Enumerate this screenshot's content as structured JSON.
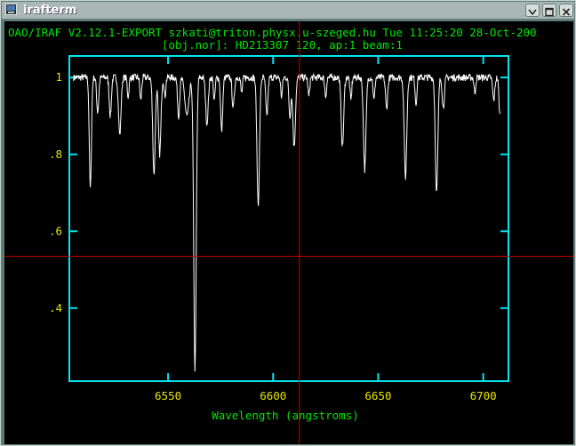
{
  "window": {
    "title": "irafterm",
    "buttons": [
      "minimize",
      "maximize",
      "close"
    ]
  },
  "header": {
    "line1": "OAO/IRAF V2.12.1-EXPORT szkati@triton.physx.u-szeged.hu Tue 11:25:20 28-Oct-200",
    "line2": "[obj.nor]: HD213307 120, ap:1 beam:1"
  },
  "colors": {
    "axes": "#00e5ee",
    "tick_labels": "#e6e600",
    "header_text": "#00e600",
    "spectrum": "#ffffff",
    "cursor": "#cc0000",
    "background": "#000000"
  },
  "chart_data": {
    "type": "line",
    "title": "",
    "xlabel": "Wavelength (angstroms)",
    "ylabel": "",
    "xlim": [
      6503,
      6712
    ],
    "ylim": [
      0.21,
      1.056
    ],
    "x_ticks": [
      6550,
      6600,
      6650,
      6700
    ],
    "x_tick_labels": [
      "6550",
      "6600",
      "6650",
      "6700"
    ],
    "y_ticks": [
      1.0,
      0.8,
      0.6,
      0.4
    ],
    "y_tick_labels": [
      "1",
      ".8",
      ".6",
      ".4"
    ],
    "grid": false,
    "continuum": 1.0,
    "absorption_lines": [
      {
        "x": 6513.0,
        "depth": 0.29,
        "width": 0.5
      },
      {
        "x": 6516.5,
        "depth": 0.09,
        "width": 0.5
      },
      {
        "x": 6522.5,
        "depth": 0.1,
        "width": 0.5
      },
      {
        "x": 6527.0,
        "depth": 0.15,
        "width": 0.6
      },
      {
        "x": 6531.0,
        "depth": 0.05,
        "width": 0.4
      },
      {
        "x": 6537.0,
        "depth": 0.06,
        "width": 0.4
      },
      {
        "x": 6543.3,
        "depth": 0.25,
        "width": 0.6
      },
      {
        "x": 6546.0,
        "depth": 0.2,
        "width": 0.6
      },
      {
        "x": 6548.5,
        "depth": 0.05,
        "width": 0.4
      },
      {
        "x": 6555.0,
        "depth": 0.1,
        "width": 0.5
      },
      {
        "x": 6559.0,
        "depth": 0.1,
        "width": 1.0
      },
      {
        "x": 6562.8,
        "depth": 0.76,
        "width": 0.6
      },
      {
        "x": 6568.5,
        "depth": 0.12,
        "width": 0.6
      },
      {
        "x": 6572.0,
        "depth": 0.06,
        "width": 0.4
      },
      {
        "x": 6575.5,
        "depth": 0.14,
        "width": 0.5
      },
      {
        "x": 6581.0,
        "depth": 0.08,
        "width": 0.5
      },
      {
        "x": 6585.0,
        "depth": 0.04,
        "width": 0.4
      },
      {
        "x": 6592.9,
        "depth": 0.33,
        "width": 0.6
      },
      {
        "x": 6597.0,
        "depth": 0.1,
        "width": 0.5
      },
      {
        "x": 6604.0,
        "depth": 0.05,
        "width": 0.4
      },
      {
        "x": 6608.0,
        "depth": 0.1,
        "width": 0.5
      },
      {
        "x": 6610.0,
        "depth": 0.18,
        "width": 0.6
      },
      {
        "x": 6617.0,
        "depth": 0.05,
        "width": 0.4
      },
      {
        "x": 6625.0,
        "depth": 0.05,
        "width": 0.4
      },
      {
        "x": 6633.0,
        "depth": 0.18,
        "width": 0.6
      },
      {
        "x": 6637.0,
        "depth": 0.06,
        "width": 0.4
      },
      {
        "x": 6643.6,
        "depth": 0.24,
        "width": 0.6
      },
      {
        "x": 6648.0,
        "depth": 0.06,
        "width": 0.4
      },
      {
        "x": 6654.0,
        "depth": 0.08,
        "width": 0.5
      },
      {
        "x": 6663.0,
        "depth": 0.26,
        "width": 0.6
      },
      {
        "x": 6668.0,
        "depth": 0.07,
        "width": 0.4
      },
      {
        "x": 6677.8,
        "depth": 0.3,
        "width": 0.6
      },
      {
        "x": 6681.0,
        "depth": 0.08,
        "width": 0.5
      },
      {
        "x": 6696.0,
        "depth": 0.04,
        "width": 0.4
      },
      {
        "x": 6705.0,
        "depth": 0.06,
        "width": 0.5
      },
      {
        "x": 6708.0,
        "depth": 0.1,
        "width": 0.5
      }
    ],
    "cursor": {
      "x": 6612.5,
      "y": 0.535
    }
  }
}
